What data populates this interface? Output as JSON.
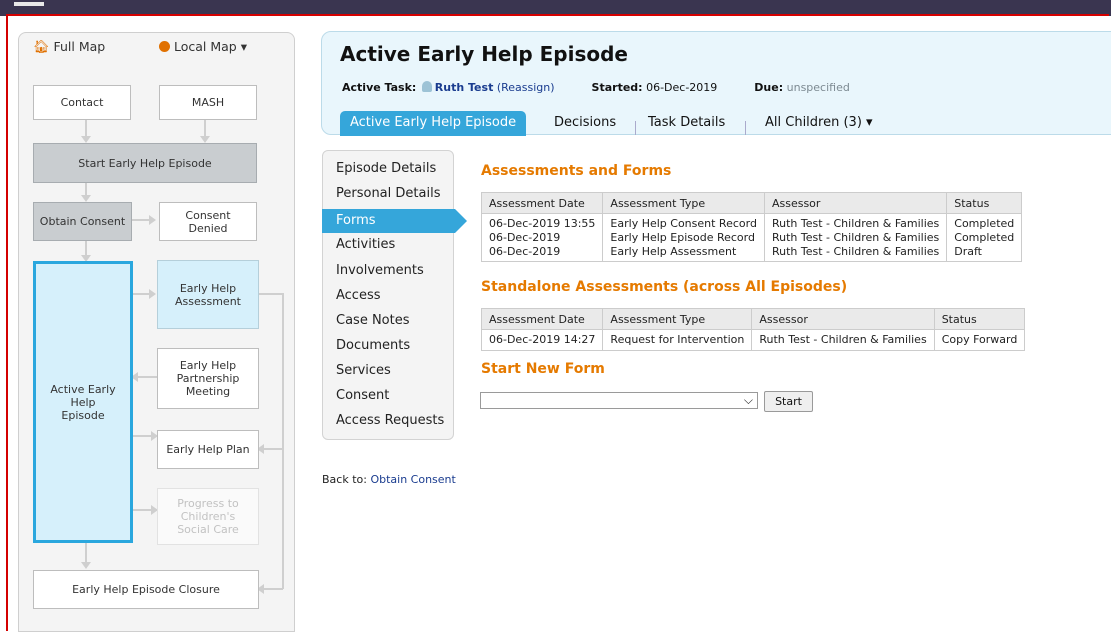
{
  "map": {
    "full_map": "Full Map",
    "local_map": "Local Map ▾",
    "nodes": {
      "contact": "Contact",
      "mash": "MASH",
      "start": "Start Early Help Episode",
      "obtain_consent": "Obtain Consent",
      "consent_denied": "Consent Denied",
      "active": "Active Early Help Episode",
      "assessment": "Early Help Assessment",
      "partnership": "Early Help Partnership Meeting",
      "plan": "Early Help Plan",
      "progress": "Progress to Children's Social Care",
      "closure": "Early Help Episode Closure"
    }
  },
  "header": {
    "title": "Active Early Help Episode",
    "active_task_label": "Active Task:",
    "person": "Ruth Test",
    "reassign": "(Reassign)",
    "started_label": "Started:",
    "started_value": "06-Dec-2019",
    "due_label": "Due:",
    "due_value": "unspecified",
    "tabs": [
      "Active Early Help Episode",
      "Decisions",
      "Task Details",
      "All Children (3) ▾"
    ]
  },
  "subnav": [
    "Episode Details",
    "Personal Details",
    "Forms",
    "Activities",
    "Involvements",
    "Access",
    "Case Notes",
    "Documents",
    "Services",
    "Consent",
    "Access Requests"
  ],
  "back_to": {
    "label": "Back to:",
    "link": "Obtain Consent"
  },
  "assessments": {
    "title": "Assessments and Forms",
    "columns": [
      "Assessment Date",
      "Assessment Type",
      "Assessor",
      "Status"
    ],
    "rows": [
      [
        "06-Dec-2019 13:55",
        "Early Help Consent Record",
        "Ruth Test - Children & Families",
        "Completed"
      ],
      [
        "06-Dec-2019",
        "Early Help Episode Record",
        "Ruth Test - Children & Families",
        "Completed"
      ],
      [
        "06-Dec-2019",
        "Early Help Assessment",
        "Ruth Test - Children & Families",
        "Draft"
      ]
    ]
  },
  "standalone": {
    "title": "Standalone Assessments (across All Episodes)",
    "columns": [
      "Assessment Date",
      "Assessment Type",
      "Assessor",
      "Status"
    ],
    "rows": [
      [
        "06-Dec-2019 14:27",
        "Request for Intervention",
        "Ruth Test - Children & Families",
        "Copy Forward"
      ]
    ]
  },
  "start_form": {
    "title": "Start New Form",
    "selected": "",
    "button": "Start"
  },
  "colors": {
    "accent": "#35a6da",
    "section": "#e57a00",
    "link": "#1a3c8f",
    "topbar": "#3a3550"
  },
  "icons": {
    "full_map": "home-icon",
    "local_map": "location-dot-icon",
    "person": "person-icon",
    "dropdown": "chevron-down-icon"
  }
}
